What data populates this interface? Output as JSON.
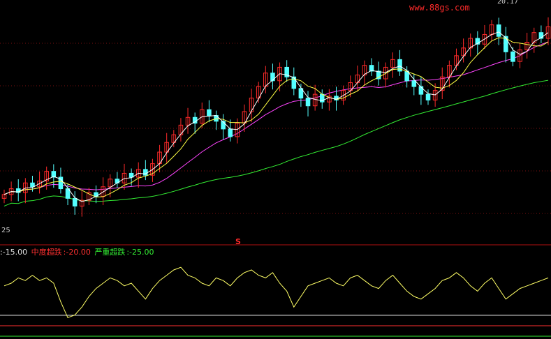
{
  "watermark": "www.88gs.com",
  "peak_label": "20.17",
  "upper_axis_label": "25",
  "signal_marker": "S",
  "legend": {
    "item1": ":-15.00",
    "item2_label": "中度超跌",
    "item2_value": ":-20.00",
    "item3_label": "严重超跌",
    "item3_value": ":-25.00"
  },
  "colors": {
    "up": "#ff2a2a",
    "down": "#54ffff",
    "ma_fast": "#ffffff",
    "ma_mid": "#ffff44",
    "ma_slow": "#ff44ff",
    "ma_long": "#33ee33",
    "oscillator": "#ffff66",
    "legend_white": "#dddddd",
    "legend_red": "#ff3030",
    "legend_green": "#33ee33"
  },
  "chart_data": [
    {
      "type": "candlestick",
      "close": [
        11.2,
        11.5,
        11.3,
        11.8,
        11.6,
        11.9,
        12.4,
        12.1,
        11.5,
        11.0,
        10.6,
        10.9,
        11.3,
        11.1,
        11.6,
        12.0,
        11.8,
        12.3,
        12.1,
        12.5,
        12.2,
        12.8,
        13.4,
        13.9,
        14.3,
        14.8,
        15.2,
        14.9,
        15.6,
        15.3,
        15.0,
        14.6,
        14.2,
        14.9,
        15.5,
        16.2,
        16.8,
        17.5,
        17.1,
        17.8,
        17.3,
        16.7,
        16.2,
        15.8,
        16.4,
        16.0,
        16.3,
        16.1,
        16.6,
        17.0,
        17.4,
        17.9,
        17.6,
        17.2,
        17.8,
        18.2,
        17.6,
        17.1,
        16.8,
        16.4,
        16.1,
        16.6,
        17.3,
        17.9,
        18.4,
        18.8,
        19.3,
        19.0,
        19.5,
        20.0,
        19.4,
        18.6,
        18.1,
        18.7,
        19.1,
        19.6,
        19.3,
        19.9
      ],
      "ylim": [
        10,
        21
      ],
      "moving_averages": [
        "ma_fast",
        "ma_mid",
        "ma_slow",
        "ma_long"
      ]
    },
    {
      "type": "line",
      "name": "oscillator",
      "values": [
        -6,
        -5,
        -3,
        -4,
        -2,
        -4,
        -3,
        -5,
        -12,
        -18,
        -17,
        -14,
        -10,
        -7,
        -5,
        -3,
        -4,
        -6,
        -5,
        -8,
        -11,
        -7,
        -4,
        -2,
        0,
        1,
        -2,
        -3,
        -5,
        -6,
        -3,
        -4,
        -6,
        -3,
        -1,
        0,
        -2,
        -3,
        -1,
        -5,
        -8,
        -14,
        -10,
        -6,
        -5,
        -4,
        -3,
        -5,
        -6,
        -3,
        -2,
        -4,
        -6,
        -7,
        -4,
        -2,
        -5,
        -8,
        -10,
        -11,
        -9,
        -7,
        -4,
        -3,
        -1,
        -3,
        -6,
        -8,
        -5,
        -3,
        -7,
        -11,
        -9,
        -7,
        -6,
        -5,
        -4,
        -3
      ],
      "ylim": [
        -25,
        5
      ],
      "reference_lines": [
        -15,
        -20,
        -25
      ]
    }
  ]
}
